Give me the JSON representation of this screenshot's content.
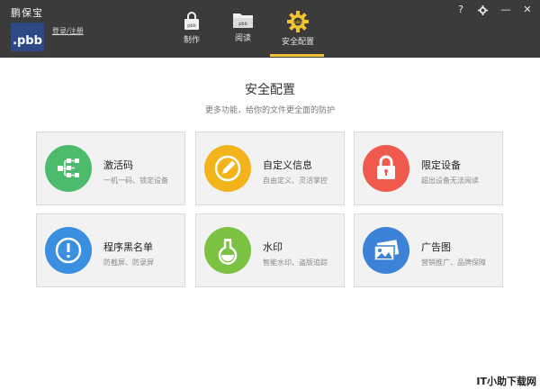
{
  "app": {
    "title": "鹏保宝",
    "logo_text": ".pbb",
    "login_link": "登录/注册"
  },
  "tabs": [
    {
      "label": "制作",
      "icon": "lock-file-icon"
    },
    {
      "label": "阅读",
      "icon": "folder-icon"
    },
    {
      "label": "安全配置",
      "icon": "gear-icon",
      "active": true
    }
  ],
  "window_controls": {
    "help": "?",
    "minimize": "—",
    "close": "✕"
  },
  "main": {
    "title": "安全配置",
    "subtitle": "更多功能，给你的文件更全面的防护"
  },
  "cards": [
    {
      "title": "激活码",
      "desc": "一机一码、锁定设备",
      "color": "#4cbb6c",
      "icon": "network-icon"
    },
    {
      "title": "自定义信息",
      "desc": "自由定义、灵活掌控",
      "color": "#f3b31b",
      "icon": "pencil-icon"
    },
    {
      "title": "限定设备",
      "desc": "超出设备无法阅读",
      "color": "#f05a4c",
      "icon": "padlock-icon"
    },
    {
      "title": "程序黑名单",
      "desc": "防截屏、防录屏",
      "color": "#3a8fe0",
      "icon": "alert-icon"
    },
    {
      "title": "水印",
      "desc": "智能水印、盗版追踪",
      "color": "#7cc242",
      "icon": "flask-icon"
    },
    {
      "title": "广告图",
      "desc": "营销推广、品牌保障",
      "color": "#3c82d6",
      "icon": "image-icon"
    }
  ],
  "watermark": "IT小助下载网"
}
